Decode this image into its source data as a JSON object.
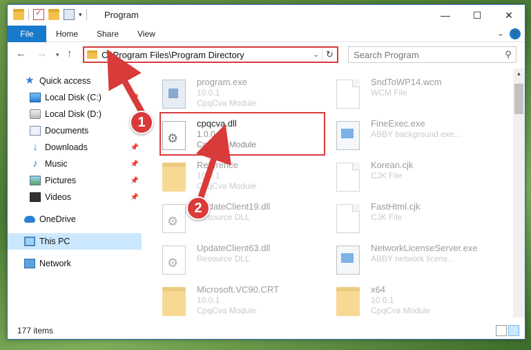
{
  "window": {
    "title": "Program",
    "tabs": [
      {
        "label": "File"
      },
      {
        "label": "Home"
      },
      {
        "label": "Share"
      },
      {
        "label": "View"
      }
    ]
  },
  "address": {
    "path": "C:\\Program Files\\Program Directory"
  },
  "search": {
    "placeholder": "Search Program"
  },
  "sidebar": {
    "items": [
      {
        "label": "Quick access",
        "icon": "star-icon"
      },
      {
        "label": "Local Disk (C:)",
        "icon": "drive-icon"
      },
      {
        "label": "Local Disk (D:)",
        "icon": "drive-icon"
      },
      {
        "label": "Documents",
        "icon": "documents-icon"
      },
      {
        "label": "Downloads",
        "icon": "download-icon"
      },
      {
        "label": "Music",
        "icon": "music-icon"
      },
      {
        "label": "Pictures",
        "icon": "pictures-icon"
      },
      {
        "label": "Videos",
        "icon": "videos-icon"
      },
      {
        "label": "OneDrive",
        "icon": "cloud-icon"
      },
      {
        "label": "This PC",
        "icon": "computer-icon"
      },
      {
        "label": "Network",
        "icon": "network-icon"
      }
    ]
  },
  "files": [
    {
      "name": "program.exe",
      "line1": "10.0.1",
      "line2": "CpqCva Module",
      "icon": "application-icon"
    },
    {
      "name": "SndToWP14.wcm",
      "line1": "WCM File",
      "line2": "",
      "icon": "document-icon"
    },
    {
      "name": "cpqcva.dll",
      "line1": "1.0.0.1",
      "line2": "CpqCva Module",
      "icon": "dll-gear-icon"
    },
    {
      "name": "FineExec.exe",
      "line1": "ABBY background exe...",
      "line2": "",
      "icon": "exe-icon"
    },
    {
      "name": "Reference",
      "line1": "10.0.1",
      "line2": "CpqCva Module",
      "icon": "folder-icon"
    },
    {
      "name": "Korean.cjk",
      "line1": "CJK File",
      "line2": "",
      "icon": "document-icon"
    },
    {
      "name": "UpdateClient19.dll",
      "line1": "Resource DLL",
      "line2": "",
      "icon": "dll-gear-icon"
    },
    {
      "name": "FastHtml.cjk",
      "line1": "CJK File",
      "line2": "",
      "icon": "document-icon"
    },
    {
      "name": "UpdateClient63.dll",
      "line1": "Resource DLL",
      "line2": "",
      "icon": "dll-gear-icon"
    },
    {
      "name": "NetworkLicenseServer.exe",
      "line1": "ABBY network licens...",
      "line2": "",
      "icon": "exe-icon"
    },
    {
      "name": "Microsoft.VC90.CRT",
      "line1": "10.0.1",
      "line2": "CpqCva Module",
      "icon": "folder-icon"
    },
    {
      "name": "x64",
      "line1": "10.0.1",
      "line2": "CpqCva Module",
      "icon": "folder-icon"
    }
  ],
  "status": {
    "count": "177 items"
  },
  "annotations": [
    {
      "label": "1"
    },
    {
      "label": "2"
    }
  ],
  "colors": {
    "accent": "#1979ca",
    "highlight": "#d93a3a",
    "selected": "#cce8ff"
  }
}
